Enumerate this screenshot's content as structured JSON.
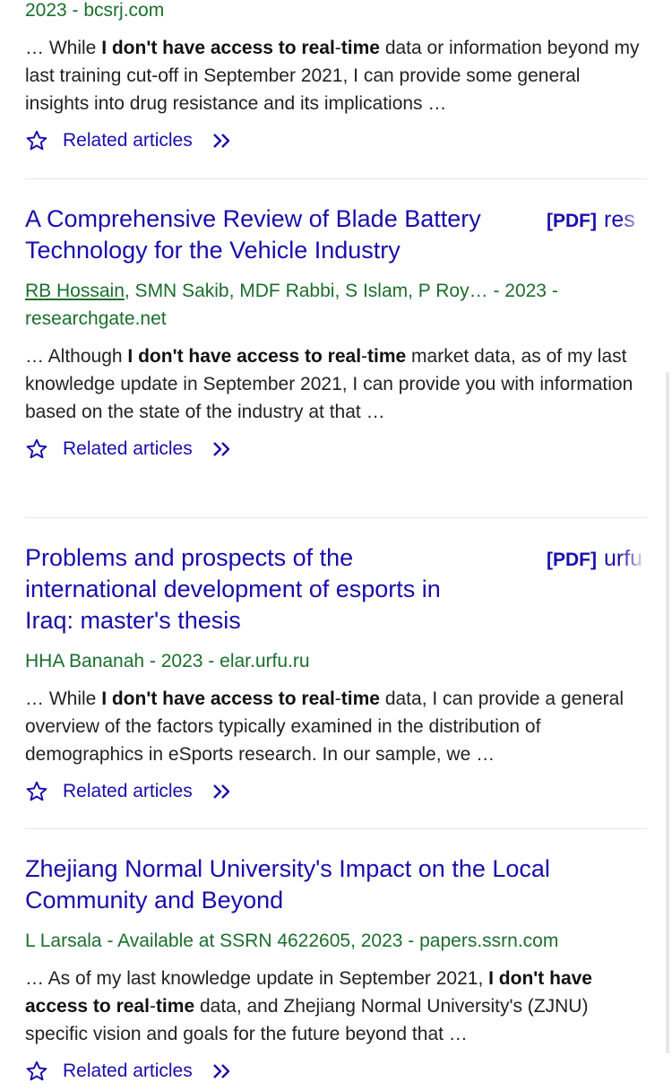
{
  "top_result": {
    "meta": "2023 - bcsrj.com",
    "snippet": [
      {
        "t": "… While ",
        "b": false
      },
      {
        "t": "I don't have access to real",
        "b": true
      },
      {
        "t": "-",
        "b": false
      },
      {
        "t": "time",
        "b": true
      },
      {
        "t": " data or information beyond my last training cut-off in September 2021, I can provide some general insights into drug resistance and its implications …",
        "b": false
      }
    ],
    "related_label": "Related articles"
  },
  "results": [
    {
      "title": "A Comprehensive Review of Blade Battery Technology for the Vehicle Industry",
      "pdf_tag": "[PDF]",
      "pdf_host": "res",
      "authors_first": "RB Hossain",
      "authors_rest": ", SMN Sakib, MDF Rabbi, S Islam, P Roy… - 2023 - researchgate.net",
      "snippet": [
        {
          "t": "… Although ",
          "b": false
        },
        {
          "t": "I don't have access to real",
          "b": true
        },
        {
          "t": "-",
          "b": false
        },
        {
          "t": "time",
          "b": true
        },
        {
          "t": " market data, as of my last knowledge update in September 2021, I can provide you with information based on the state of the industry at that …",
          "b": false
        }
      ],
      "related_label": "Related articles"
    },
    {
      "title": "Problems and prospects of the international development of esports in Iraq: master's thesis",
      "pdf_tag": "[PDF]",
      "pdf_host": "urfu",
      "authors_first": "",
      "authors_rest": "HHA Bananah - 2023 - elar.urfu.ru",
      "snippet": [
        {
          "t": "… While ",
          "b": false
        },
        {
          "t": "I don't have access to real",
          "b": true
        },
        {
          "t": "-",
          "b": false
        },
        {
          "t": "time",
          "b": true
        },
        {
          "t": " data, I can provide a general overview of the factors typically examined in the distribution of demographics in eSports research. In our sample, we …",
          "b": false
        }
      ],
      "related_label": "Related articles"
    },
    {
      "title": "Zhejiang Normal University's Impact on the Local Community and Beyond",
      "pdf_tag": "",
      "pdf_host": "",
      "authors_first": "",
      "authors_rest": "L Larsala - Available at SSRN 4622605, 2023 - papers.ssrn.com",
      "snippet": [
        {
          "t": "… As of my last knowledge update in September 2021, ",
          "b": false
        },
        {
          "t": "I don't have access to real",
          "b": true
        },
        {
          "t": "-",
          "b": false
        },
        {
          "t": "time",
          "b": true
        },
        {
          "t": " data, and Zhejiang Normal University's (ZJNU) specific vision and goals for the future beyond that …",
          "b": false
        }
      ],
      "related_label": "Related articles"
    }
  ],
  "colors": {
    "link": "#1a0dab",
    "meta_green": "#1a6e2c",
    "text": "#222222"
  },
  "icons": [
    "star-icon",
    "double-chevron-icon"
  ]
}
